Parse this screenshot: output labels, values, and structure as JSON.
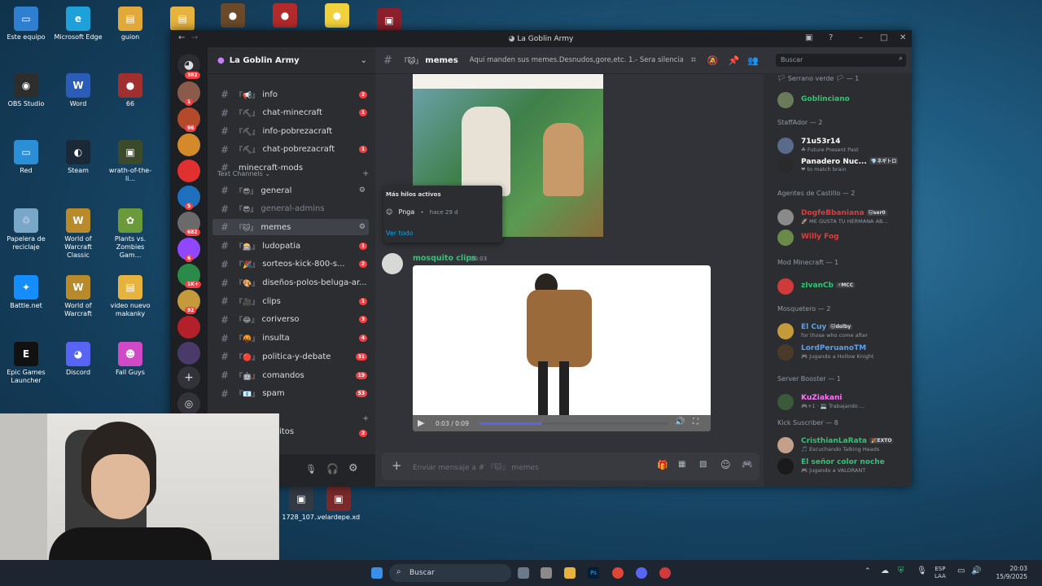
{
  "desktop": {
    "icons": [
      {
        "label": "Este equipo",
        "color": "#2f7fd0",
        "glyph": "▭"
      },
      {
        "label": "Microsoft Edge",
        "color": "#1ea0d8",
        "glyph": "e"
      },
      {
        "label": "guion",
        "color": "#e1a93a",
        "glyph": "▤"
      },
      {
        "label": "",
        "color": "#e6b33e",
        "glyph": "▤"
      },
      {
        "label": "",
        "color": "#6b4a2a",
        "glyph": "●"
      },
      {
        "label": "",
        "color": "#b32a2a",
        "glyph": "●"
      },
      {
        "label": "",
        "color": "#f2d23c",
        "glyph": "●"
      },
      {
        "label": "",
        "color": "#8b1f2b",
        "glyph": "▣"
      },
      {
        "label": "OBS Studio",
        "color": "#2d2d2d",
        "glyph": "◉"
      },
      {
        "label": "Word",
        "color": "#2b5cb8",
        "glyph": "W"
      },
      {
        "label": "66",
        "color": "#a03030",
        "glyph": "●"
      },
      {
        "label": "Red",
        "color": "#2b8fd8",
        "glyph": "▭"
      },
      {
        "label": "Steam",
        "color": "#1b2838",
        "glyph": "◐"
      },
      {
        "label": "wrath-of-the-li...",
        "color": "#3a4a2a",
        "glyph": "▣"
      },
      {
        "label": "Papelera de reciclaje",
        "color": "#7aa7c7",
        "glyph": "♲"
      },
      {
        "label": "World of Warcraft Classic",
        "color": "#b88a2a",
        "glyph": "W"
      },
      {
        "label": "Plants vs. Zombies Gam...",
        "color": "#6a9a3a",
        "glyph": "✿"
      },
      {
        "label": "Battle.net",
        "color": "#148eff",
        "glyph": "✦"
      },
      {
        "label": "World of Warcraft",
        "color": "#b88a2a",
        "glyph": "W"
      },
      {
        "label": "video nuevo makanky",
        "color": "#e6b33e",
        "glyph": "▤"
      },
      {
        "label": "Epic Games Launcher",
        "color": "#111111",
        "glyph": "E"
      },
      {
        "label": "Discord",
        "color": "#5865f2",
        "glyph": "◕"
      },
      {
        "label": "Fall Guys",
        "color": "#d04ac8",
        "glyph": "☻"
      },
      {
        "label": "1728_107...",
        "color": "#333a44",
        "glyph": "▣"
      },
      {
        "label": "velardepe.xd",
        "color": "#7a2a2a",
        "glyph": "▣"
      }
    ]
  },
  "window": {
    "title": "La Goblin Army",
    "controls": {
      "minimize": "–",
      "maximize": "□",
      "close": "✕"
    }
  },
  "servers": {
    "home_badge": "382",
    "items": [
      {
        "color": "#8a5a4a",
        "badge": "1"
      },
      {
        "color": "#b34a2a",
        "badge": "96"
      },
      {
        "color": "#d48a2a",
        "badge": ""
      },
      {
        "color": "#e03030",
        "badge": ""
      },
      {
        "color": "#1f6fbf",
        "badge": "5"
      },
      {
        "color": "#6a6a6a",
        "badge": "682"
      },
      {
        "color": "#9146ff",
        "badge": "6"
      },
      {
        "color": "#2a8a4a",
        "badge": "1K+"
      },
      {
        "color": "#c49a3a",
        "badge": "92"
      },
      {
        "color": "#b3202a",
        "badge": ""
      },
      {
        "color": "#4a3a6a",
        "badge": ""
      }
    ],
    "add_label": "+",
    "discover_label": "◎"
  },
  "guild": {
    "name": "La Goblin Army",
    "channels_top": [
      {
        "emoji": "『📢』",
        "name": "info",
        "count": "2"
      },
      {
        "emoji": "『⛏』",
        "name": "chat-minecraft",
        "count": "1"
      },
      {
        "emoji": "『⛏』",
        "name": "info-pobrezacraft",
        "count": ""
      },
      {
        "emoji": "『⛏』",
        "name": "chat-pobrezacraft",
        "count": "1"
      },
      {
        "emoji": "",
        "name": "minecraft-mods",
        "count": ""
      }
    ],
    "category": "Text Channels",
    "channels": [
      {
        "emoji": "『😎』",
        "name": "general",
        "count": "",
        "state": "hover"
      },
      {
        "emoji": "『😎』",
        "name": "general-admins",
        "count": "",
        "state": "muted"
      },
      {
        "emoji": "『🐱』",
        "name": "memes",
        "count": "",
        "state": "active"
      },
      {
        "emoji": "『🎰』",
        "name": "ludopatia",
        "count": "1",
        "state": ""
      },
      {
        "emoji": "『🎉』",
        "name": "sorteos-kick-800-s...",
        "count": "2",
        "state": ""
      },
      {
        "emoji": "『🎨』",
        "name": "diseños-polos-beluga-ar...",
        "count": "",
        "state": ""
      },
      {
        "emoji": "『🎥』",
        "name": "clips",
        "count": "1",
        "state": ""
      },
      {
        "emoji": "『😂』",
        "name": "coriverso",
        "count": "3",
        "state": ""
      },
      {
        "emoji": "『🤬』",
        "name": "insulta",
        "count": "4",
        "state": ""
      },
      {
        "emoji": "『🔴』",
        "name": "politica-y-debate",
        "count": "31",
        "state": ""
      },
      {
        "emoji": "『🤖』",
        "name": "comandos",
        "count": "19",
        "state": ""
      },
      {
        "emoji": "『📧』",
        "name": "spam",
        "count": "53",
        "state": ""
      }
    ],
    "partial_channel": "itos",
    "partial_count": "2"
  },
  "chat": {
    "channel_emoji": "『🐱』",
    "channel_name": "memes",
    "topic": "Aqui manden sus memes.Desnudos,gore,etc. 1.- Sera silenciado...",
    "search_placeholder": "Buscar",
    "threads_popup": {
      "title": "Más hilos activos",
      "thread_name": "Pnga",
      "thread_age": "hace 29 d",
      "see_all": "Ver todo"
    },
    "message": {
      "author": "mosquito clips",
      "time": "20:03",
      "video_time": "0:03 / 0:09",
      "video_progress": 0.33
    },
    "input_placeholder": "Enviar mensaje a # 『🐱』 memes"
  },
  "members": {
    "groups": [
      {
        "title": "🏳 Serrano verde 🏳 — 1",
        "members": [
          {
            "name": "Goblinciano",
            "color": "#2dc770",
            "status": "",
            "tag": "",
            "avatar": "#6a7a5a"
          }
        ]
      },
      {
        "title": "StaffAdor — 2",
        "members": [
          {
            "name": "71u53r14",
            "color": "#ffffff",
            "status": "☘ Future Present Past",
            "tag": "",
            "avatar": "#5a6a8a"
          },
          {
            "name": "Panadero Nuc...",
            "color": "#ffffff",
            "status": "❤ to match brain",
            "tag": "💎ネギトロ",
            "avatar": "#2a2a2a"
          }
        ]
      },
      {
        "title": "Agentes de Castillo — 2",
        "members": [
          {
            "name": "DogfeBbaniana",
            "color": "#e23a3a",
            "status": "🚀 ME GUSTA TU HERMANA AB...",
            "tag": "🐱ser0",
            "avatar": "#8a8a8a"
          },
          {
            "name": "Willy Fog",
            "color": "#e23a3a",
            "status": "",
            "tag": "",
            "avatar": "#6a8a4a"
          }
        ]
      },
      {
        "title": "Mod Minecraft — 1",
        "members": [
          {
            "name": "zIvanCb",
            "color": "#2dc770",
            "status": "",
            "tag": "⚡MCC",
            "avatar": "#d03a3a"
          }
        ]
      },
      {
        "title": "Mosquetero — 2",
        "members": [
          {
            "name": "El Cuy",
            "color": "#5aa0f0",
            "status": "for those who come after",
            "tag": "🐱dolby",
            "avatar": "#c49a3a"
          },
          {
            "name": "LordPeruanoTM",
            "color": "#5aa0f0",
            "status": "🎮 Jugando a Hollow Knight",
            "tag": "",
            "avatar": "#4a3a2a"
          }
        ]
      },
      {
        "title": "Server Booster — 1",
        "members": [
          {
            "name": "KuZiakani",
            "color": "#ff73fa",
            "status": "🎮+1 · 💻 Trabajando ...",
            "tag": "",
            "avatar": "#3a5a3a"
          }
        ]
      },
      {
        "title": "Kick Suscriber — 8",
        "members": [
          {
            "name": "CristhianLaRata",
            "color": "#2dc770",
            "status": "🎵 Escuchando Talking Heads",
            "tag": "🎉EXTO",
            "avatar": "#c4a08a"
          },
          {
            "name": "El señor color noche",
            "color": "#2dc770",
            "status": "🎮 Jugando a VALORANT",
            "tag": "",
            "avatar": "#1a1a1a"
          }
        ]
      }
    ]
  },
  "taskbar": {
    "search_label": "Buscar",
    "lang": "ESP",
    "lang2": "LAA",
    "time": "20:03",
    "date": "15/9/2025"
  }
}
